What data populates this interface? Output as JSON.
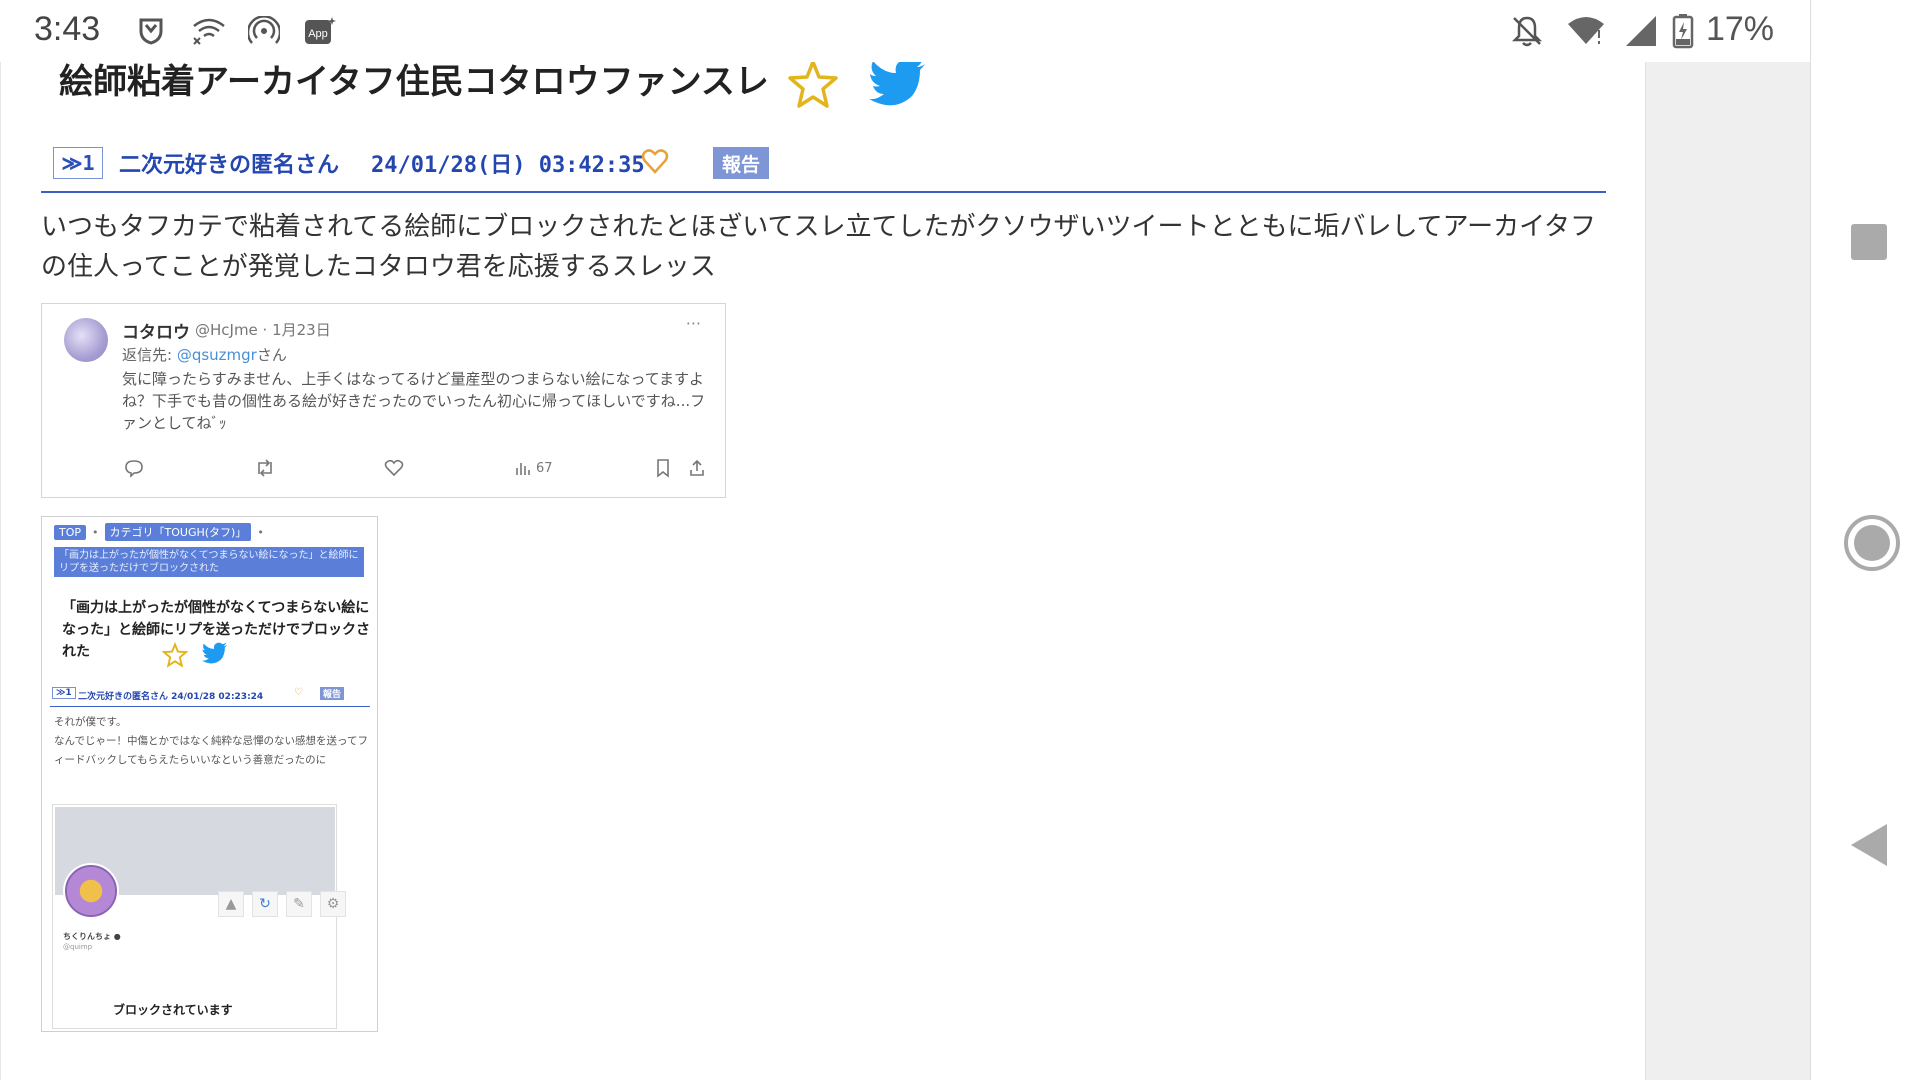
{
  "status_bar": {
    "time": "3:43",
    "icons": [
      "shield-icon",
      "wifi-x-icon",
      "hotspot-icon",
      "app-icon"
    ],
    "app_icon_label": "App",
    "battery_percent": "17%"
  },
  "thread": {
    "title": "絵師粘着アーカイタフ住民コタロウファンスレ"
  },
  "post": {
    "number": "≫1",
    "poster": "二次元好きの匿名さん",
    "datetime": "24/01/28(日) 03:42:35",
    "report_label": "報告",
    "body": "いつもタフカテで粘着されてる絵師にブロックされたとほざいてスレ立てしたがクソウザいツイートとともに垢バレしてアーカイタフの住人ってことが発覚したコタロウ君を応援するスレッス"
  },
  "tweet": {
    "name": "コタロウ",
    "handle_date": "@HcJme · 1月23日",
    "reply_prefix": "返信先: ",
    "reply_to": "@qsuzmgr",
    "reply_suffix": "さん",
    "text": "気に障ったらすみません、上手くはなってるけど量産型のつまらない絵になってますよね？下手でも昔の個性ある絵が好きだったのでいったん初心に帰ってほしいですね...ファンとしてねﾞｯ",
    "views": "67",
    "more": "···"
  },
  "screenshot": {
    "crumb_top": "TOP",
    "crumb_category": "カテゴリ「TOUGH(タフ)」",
    "crumb_current": "「画力は上がったが個性がなくてつまらない絵になった」と絵師にリプを送っただけでブロックされた",
    "title": "「画力は上がったが個性がなくてつまらない絵になった」と絵師にリプを送っただけでブロックされた",
    "res_number": "≫1",
    "poster_date": "二次元好きの匿名さん 24/01/28 02:23:24",
    "report_label": "報告",
    "body_line1": "それが僕です。",
    "body_line2": "なんでじゃー！中傷とかではなく純粋な忌憚のない感想を送ってフィードバックしてもらえたらいいなという善意だったのに",
    "embed_name": "ちくりんちょ ●",
    "embed_handle": "@quimp",
    "embed_blocked": "ブロックされています"
  },
  "colors": {
    "link_blue": "#2346b0",
    "accent_blue": "#3b5fc6",
    "report_bg": "#7f96d6",
    "star": "#e2b51c",
    "twitter": "#1d9bf0",
    "heart": "#e6a33a"
  }
}
